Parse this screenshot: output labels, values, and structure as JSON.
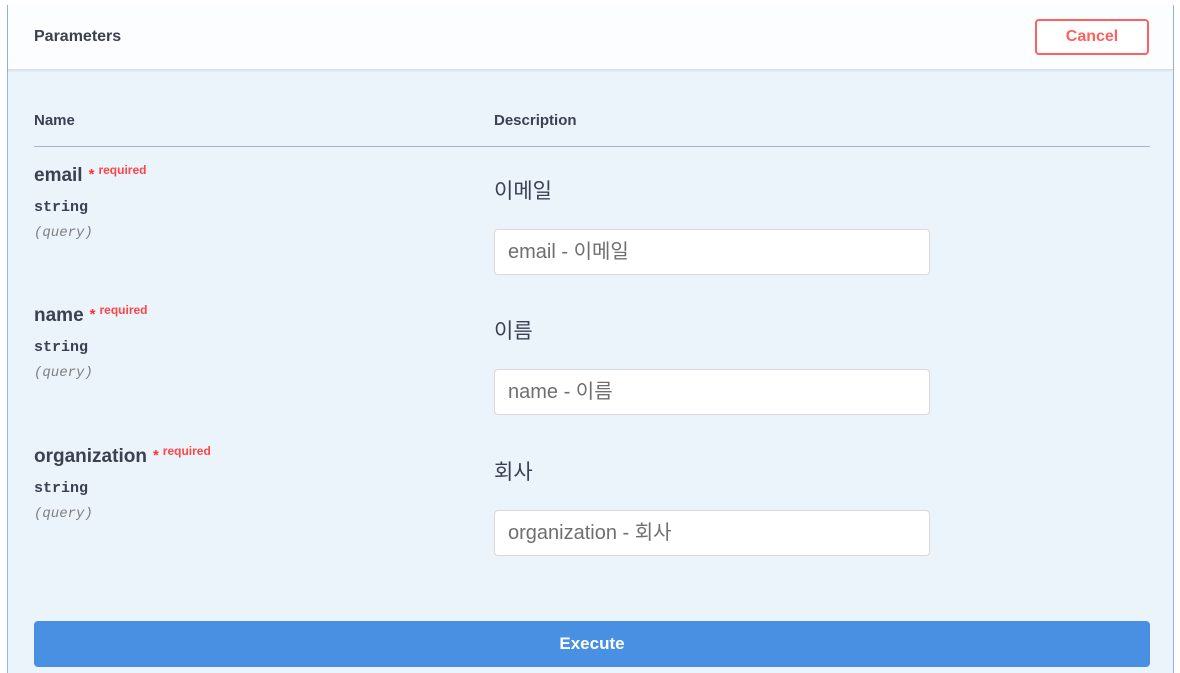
{
  "header": {
    "title": "Parameters",
    "cancel_label": "Cancel"
  },
  "table": {
    "name_header": "Name",
    "description_header": "Description"
  },
  "parameters": [
    {
      "name": "email",
      "required_mark": "*",
      "required_label": "required",
      "type": "string",
      "location": "(query)",
      "description": "이메일",
      "placeholder": "email - 이메일",
      "value": ""
    },
    {
      "name": "name",
      "required_mark": "*",
      "required_label": "required",
      "type": "string",
      "location": "(query)",
      "description": "이름",
      "placeholder": "name - 이름",
      "value": ""
    },
    {
      "name": "organization",
      "required_mark": "*",
      "required_label": "required",
      "type": "string",
      "location": "(query)",
      "description": "회사",
      "placeholder": "organization - 회사",
      "value": ""
    }
  ],
  "actions": {
    "execute_label": "Execute"
  },
  "colors": {
    "panel_background": "#ebf3fb",
    "cancel": "#ff6060",
    "required": "#ff4545",
    "execute": "#4a90e2"
  }
}
